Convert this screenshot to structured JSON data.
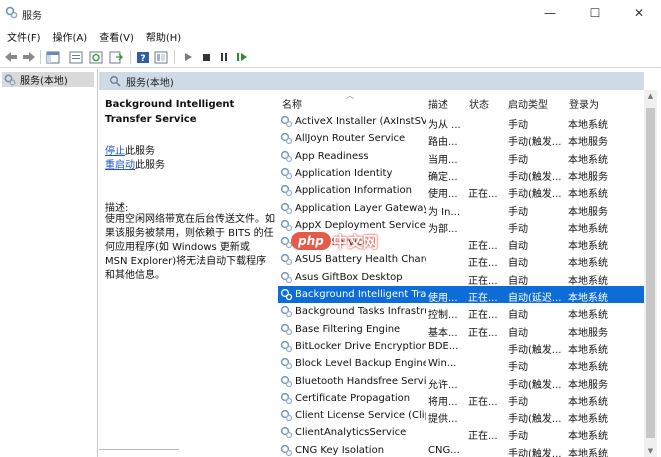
{
  "window": {
    "title": "服务",
    "controls": {
      "minimize": "—",
      "maximize": "☐",
      "close": "✕"
    }
  },
  "menu": [
    "文件(F)",
    "操作(A)",
    "查看(V)",
    "帮助(H)"
  ],
  "toolbar": [
    "back-arrow-icon",
    "forward-arrow-icon",
    "console-tree-icon",
    "properties-icon",
    "refresh-icon",
    "export-icon",
    "help-icon",
    "view-icon",
    "play-icon",
    "stop-icon",
    "pause-icon",
    "restart-icon"
  ],
  "tree": {
    "item": "服务(本地)"
  },
  "pane_header": {
    "label": "服务(本地)"
  },
  "description": {
    "title": "Background Intelligent Transfer Service",
    "stop_link": "停止",
    "stop_suffix": "此服务",
    "restart_link": "重启动",
    "restart_suffix": "此服务",
    "label": "描述:",
    "body": "使用空闲网络带宽在后台传送文件。如果该服务被禁用，则依赖于 BITS 的任何应用程序(如 Windows 更新或 MSN Explorer)将无法自动下载程序和其他信息。"
  },
  "columns": {
    "name": "名称",
    "desc": "描述",
    "status": "状态",
    "startup": "启动类型",
    "logon": "登录为"
  },
  "services": [
    {
      "name": "ActiveX Installer (AxInstSV)",
      "desc": "为从 ...",
      "status": "",
      "startup": "手动",
      "logon": "本地系统"
    },
    {
      "name": "AllJoyn Router Service",
      "desc": "路由...",
      "status": "",
      "startup": "手动(触发...",
      "logon": "本地服务"
    },
    {
      "name": "App Readiness",
      "desc": "当用...",
      "status": "",
      "startup": "手动",
      "logon": "本地系统"
    },
    {
      "name": "Application Identity",
      "desc": "确定...",
      "status": "",
      "startup": "手动(触发...",
      "logon": "本地服务"
    },
    {
      "name": "Application Information",
      "desc": "使用...",
      "status": "正在...",
      "startup": "手动(触发...",
      "logon": "本地系统"
    },
    {
      "name": "Application Layer Gateway ...",
      "desc": "为 In...",
      "status": "",
      "startup": "手动",
      "logon": "本地服务"
    },
    {
      "name": "AppX Deployment Service ...",
      "desc": "为部...",
      "status": "",
      "startup": "手动",
      "logon": "本地系统"
    },
    {
      "name": "ASLDR Service",
      "desc": "",
      "status": "正在...",
      "startup": "自动",
      "logon": "本地系统"
    },
    {
      "name": "ASUS Battery Health Charg...",
      "desc": "",
      "status": "正在...",
      "startup": "自动",
      "logon": "本地系统"
    },
    {
      "name": "Asus GiftBox Desktop",
      "desc": "",
      "status": "正在...",
      "startup": "自动",
      "logon": "本地系统"
    },
    {
      "name": "Background Intelligent Tra...",
      "desc": "使用...",
      "status": "正在...",
      "startup": "自动(延迟...",
      "logon": "本地系统",
      "selected": true
    },
    {
      "name": "Background Tasks Infrastru...",
      "desc": "控制...",
      "status": "正在...",
      "startup": "自动",
      "logon": "本地系统"
    },
    {
      "name": "Base Filtering Engine",
      "desc": "基本...",
      "status": "正在...",
      "startup": "自动",
      "logon": "本地服务"
    },
    {
      "name": "BitLocker Drive Encryption ...",
      "desc": "BDE...",
      "status": "",
      "startup": "手动(触发...",
      "logon": "本地系统"
    },
    {
      "name": "Block Level Backup Engine ...",
      "desc": "Win...",
      "status": "",
      "startup": "手动",
      "logon": "本地系统"
    },
    {
      "name": "Bluetooth Handsfree Service",
      "desc": "允许...",
      "status": "",
      "startup": "手动(触发...",
      "logon": "本地服务"
    },
    {
      "name": "Certificate Propagation",
      "desc": "将用...",
      "status": "正在...",
      "startup": "手动",
      "logon": "本地系统"
    },
    {
      "name": "Client License Service (Clip...",
      "desc": "提供...",
      "status": "",
      "startup": "手动(触发...",
      "logon": "本地系统"
    },
    {
      "name": "ClientAnalyticsService",
      "desc": "",
      "status": "正在...",
      "startup": "手动",
      "logon": "本地系统"
    },
    {
      "name": "CNG Key Isolation",
      "desc": "CNG...",
      "status": "",
      "startup": "手动(触发...",
      "logon": "本地系统"
    }
  ],
  "watermark": {
    "badge": "php",
    "text": "中文网"
  },
  "colors": {
    "selection": "#0d6cd6",
    "header_band": "#cfdae7",
    "link": "#1a55c0"
  }
}
